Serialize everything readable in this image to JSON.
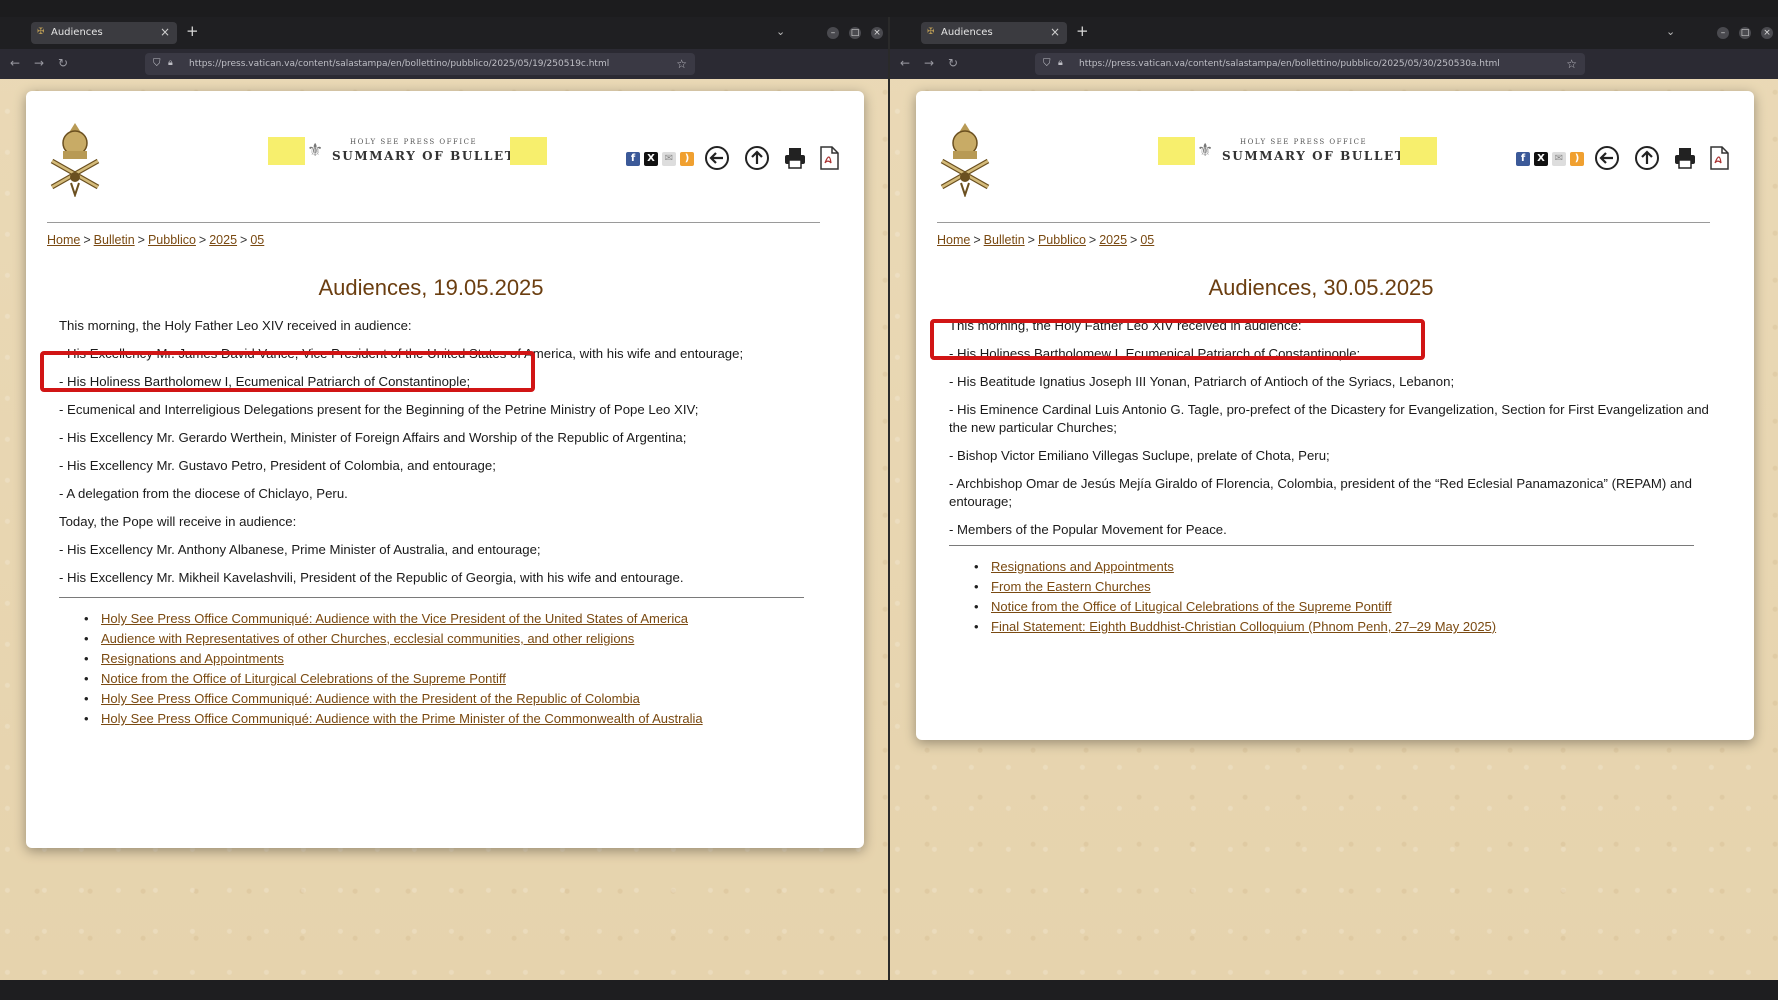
{
  "windows": [
    {
      "tab_title": "Audiences",
      "url": "https://press.vatican.va/content/salastampa/en/bollettino/pubblico/2025/05/19/250519c.html",
      "banner_small": "HOLY SEE PRESS OFFICE",
      "banner_big": "SUMMARY OF BULLETIN",
      "breadcrumb": [
        "Home",
        "Bulletin",
        "Pubblico",
        "2025",
        "05"
      ],
      "title": "Audiences, 19.05.2025",
      "paragraphs": [
        "This morning, the Holy Father Leo XIV received in audience:",
        "- His Excellency Mr. James David Vance, Vice President of the United States of America, with his wife and entourage;",
        "- His Holiness Bartholomew I, Ecumenical Patriarch of Constantinople;",
        "- Ecumenical and Interreligious Delegations present for the Beginning of the Petrine Ministry of Pope Leo XIV;",
        "- His Excellency Mr. Gerardo Werthein, Minister of Foreign Affairs and Worship of the Republic of Argentina;",
        "- His Excellency Mr. Gustavo Petro, President of Colombia, and entourage;",
        "- A delegation from the diocese of Chiclayo, Peru.",
        "Today, the Pope will receive in audience:",
        "- His Excellency Mr. Anthony Albanese, Prime Minister of Australia, and entourage;",
        "- His Excellency Mr. Mikheil Kavelashvili, President of the Republic of Georgia, with his wife and entourage."
      ],
      "links": [
        "Holy See Press Office Communiqué: Audience with the Vice President of the United States of America",
        "Audience with Representatives of other Churches, ecclesial communities, and other religions",
        "Resignations and Appointments",
        "Notice from the Office of Liturgical Celebrations of the Supreme Pontiff",
        "Holy See Press Office Communiqué: Audience with the President of the Republic of Colombia",
        "Holy See Press Office Communiqué: Audience with the Prime Minister of the Commonwealth of Australia"
      ]
    },
    {
      "tab_title": "Audiences",
      "url": "https://press.vatican.va/content/salastampa/en/bollettino/pubblico/2025/05/30/250530a.html",
      "banner_small": "HOLY SEE PRESS OFFICE",
      "banner_big": "SUMMARY OF BULLETIN",
      "breadcrumb": [
        "Home",
        "Bulletin",
        "Pubblico",
        "2025",
        "05"
      ],
      "title": "Audiences, 30.05.2025",
      "paragraphs": [
        "This morning, the Holy Father Leo XIV received in audience:",
        "- His Holiness Bartholomew I, Ecumenical Patriarch of Constantinople;",
        "- His Beatitude Ignatius Joseph III Yonan, Patriarch of Antioch of the Syriacs, Lebanon;",
        "- His Eminence Cardinal Luis Antonio G. Tagle, pro-prefect of the Dicastery for Evangelization, Section for First Evangelization and the new particular Churches;",
        "- Bishop Victor Emiliano Villegas Suclupe, prelate of Chota, Peru;",
        "- Archbishop Omar de Jesús Mejía Giraldo of Florencia, Colombia, president of the “Red Eclesial Panamazonica” (REPAM) and entourage;",
        "- Members of the Popular Movement for Peace."
      ],
      "links": [
        "Resignations and Appointments",
        "From the Eastern Churches",
        "Notice from the Office of Litugical Celebrations of the Supreme Pontiff",
        "Final Statement: Eighth Buddhist-Christian Colloquium (Phnom Penh, 27–29 May 2025)"
      ]
    }
  ],
  "colors": {
    "highlight": "#d11515",
    "link": "#7a4a12",
    "title": "#6b3e10",
    "banner_yellow": "#f7ef6d"
  },
  "icons": [
    "facebook-icon",
    "x-icon",
    "email-icon",
    "rss-icon",
    "back-arrow-icon",
    "up-arrow-icon",
    "print-icon",
    "pdf-icon"
  ]
}
